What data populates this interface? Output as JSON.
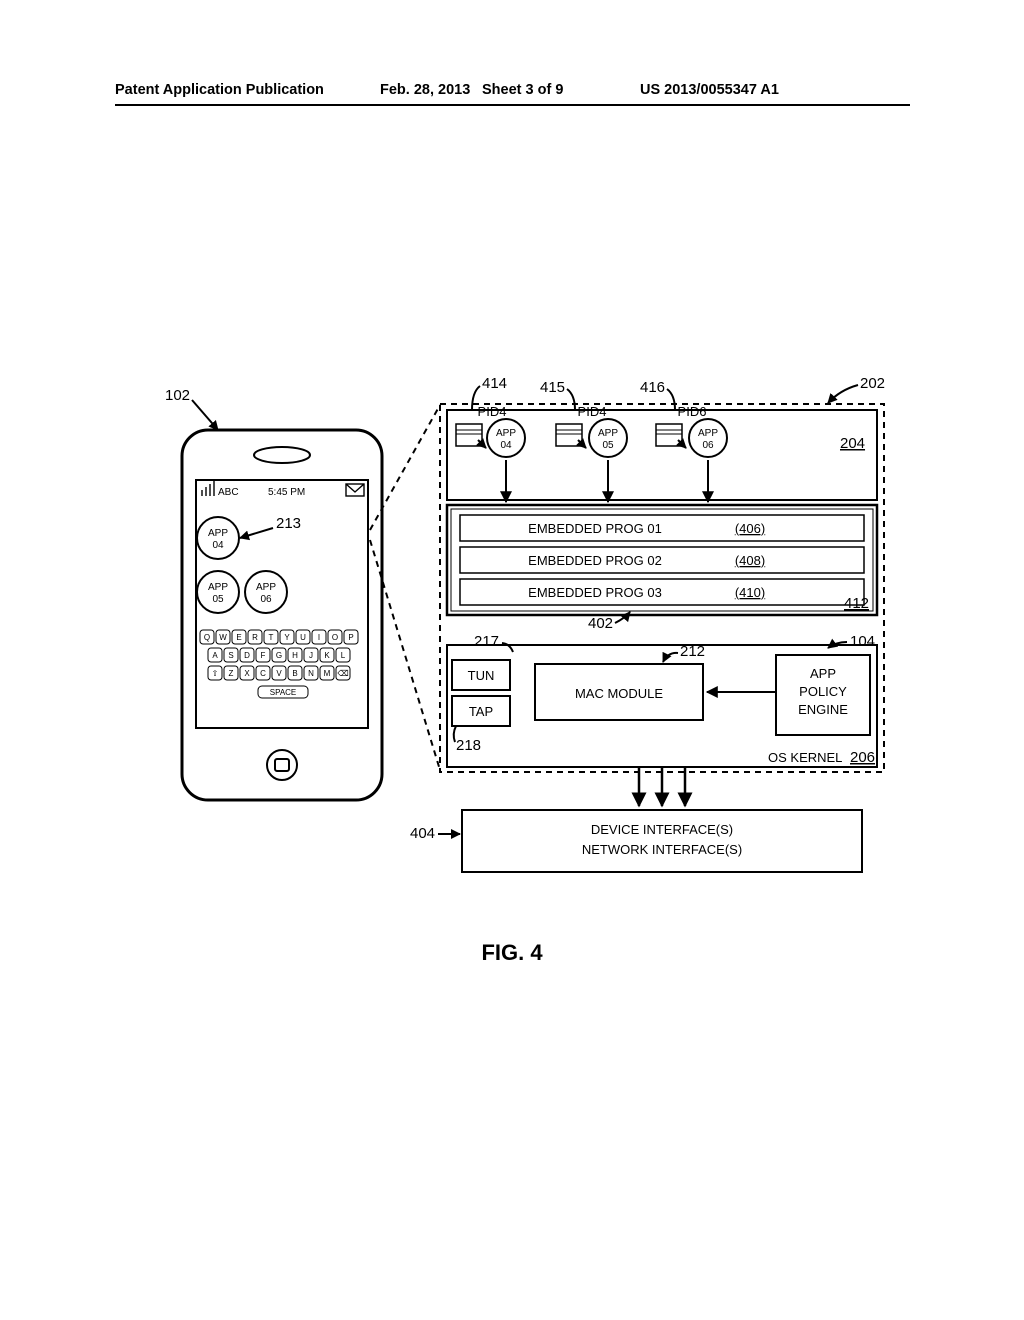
{
  "header": {
    "left": "Patent Application Publication",
    "date": "Feb. 28, 2013",
    "sheet": "Sheet 3 of 9",
    "pubno": "US 2013/0055347 A1"
  },
  "figure_label": "FIG. 4",
  "phone": {
    "ref_102": "102",
    "carrier": "ABC",
    "time": "5:45 PM",
    "app04": "APP\n04",
    "app05": "APP\n05",
    "app06": "APP\n06",
    "ref_213": "213",
    "keyboard": {
      "row1": [
        "Q",
        "W",
        "E",
        "R",
        "T",
        "Y",
        "U",
        "I",
        "O",
        "P"
      ],
      "row2": [
        "A",
        "S",
        "D",
        "F",
        "G",
        "H",
        "J",
        "K",
        "L"
      ],
      "row3": [
        "⇧",
        "Z",
        "X",
        "C",
        "V",
        "B",
        "N",
        "M",
        "⌫"
      ],
      "space": "SPACE"
    }
  },
  "system": {
    "ref_202": "202",
    "ref_414": "414",
    "ref_415": "415",
    "ref_416": "416",
    "pid4a": "PID4",
    "pid4b": "PID4",
    "pid6": "PID6",
    "app04_label": "APP\n04",
    "app05_label": "APP\n05",
    "app06_label": "APP\n06",
    "ref_204": "204",
    "embedded_heading": "",
    "prog01": "EMBEDDED PROG 01",
    "prog01_ref": "(406)",
    "prog02": "EMBEDDED PROG 02",
    "prog02_ref": "(408)",
    "prog03": "EMBEDDED PROG 03",
    "prog03_ref": "(410)",
    "ref_402": "402",
    "ref_412": "412",
    "ref_104": "104",
    "ref_217": "217",
    "ref_218": "218",
    "ref_212": "212",
    "tun": "TUN",
    "tap": "TAP",
    "mac": "MAC MODULE",
    "engine1": "APP",
    "engine2": "POLICY",
    "engine3": "ENGINE",
    "kernel": "OS KERNEL",
    "ref_206": "206",
    "ref_404": "404",
    "dev1": "DEVICE INTERFACE(S)",
    "dev2": "NETWORK INTERFACE(S)"
  }
}
